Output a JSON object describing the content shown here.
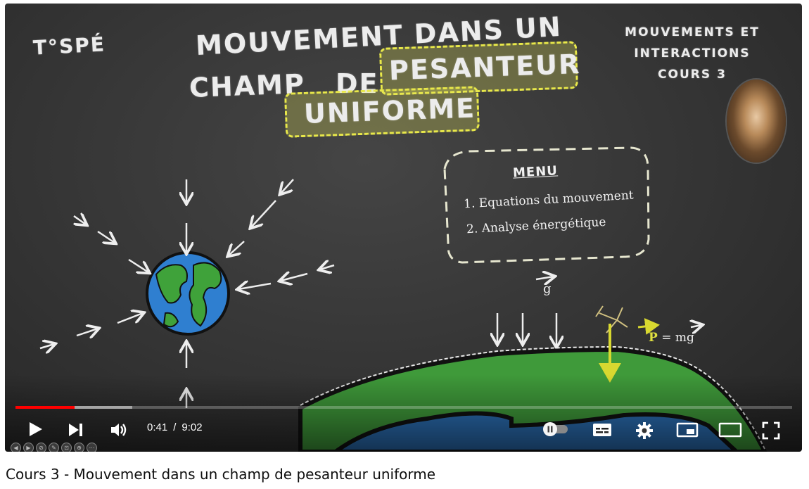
{
  "slide": {
    "level": "T°SPÉ",
    "title_line1": "MOUVEMENT DANS UN",
    "title_line2a": "CHAMP",
    "title_line2b": "DE",
    "title_highlight1": "PESANTEUR",
    "title_highlight2": "UNIFORME",
    "chapter": [
      "MOUVEMENTS ET",
      "INTERACTIONS",
      "COURS 3"
    ],
    "menu_title": "MENU",
    "menu_items": [
      "1. Equations du mouvement",
      "2. Analyse énergétique"
    ],
    "g_label": "g",
    "p_label_symbol": "P",
    "p_label_rest": "= mg"
  },
  "player": {
    "current_time": "0:41",
    "separator": "/",
    "duration": "9:02",
    "progress_played": 0.076,
    "progress_buffered": 0.15,
    "accent_color": "#ff0000",
    "mini_tools": [
      "◀",
      "▶",
      "⊘",
      "✎",
      "⊡",
      "⊕",
      "⋯"
    ]
  },
  "video_title": "Cours 3 - Mouvement dans un champ de pesanteur uniforme"
}
